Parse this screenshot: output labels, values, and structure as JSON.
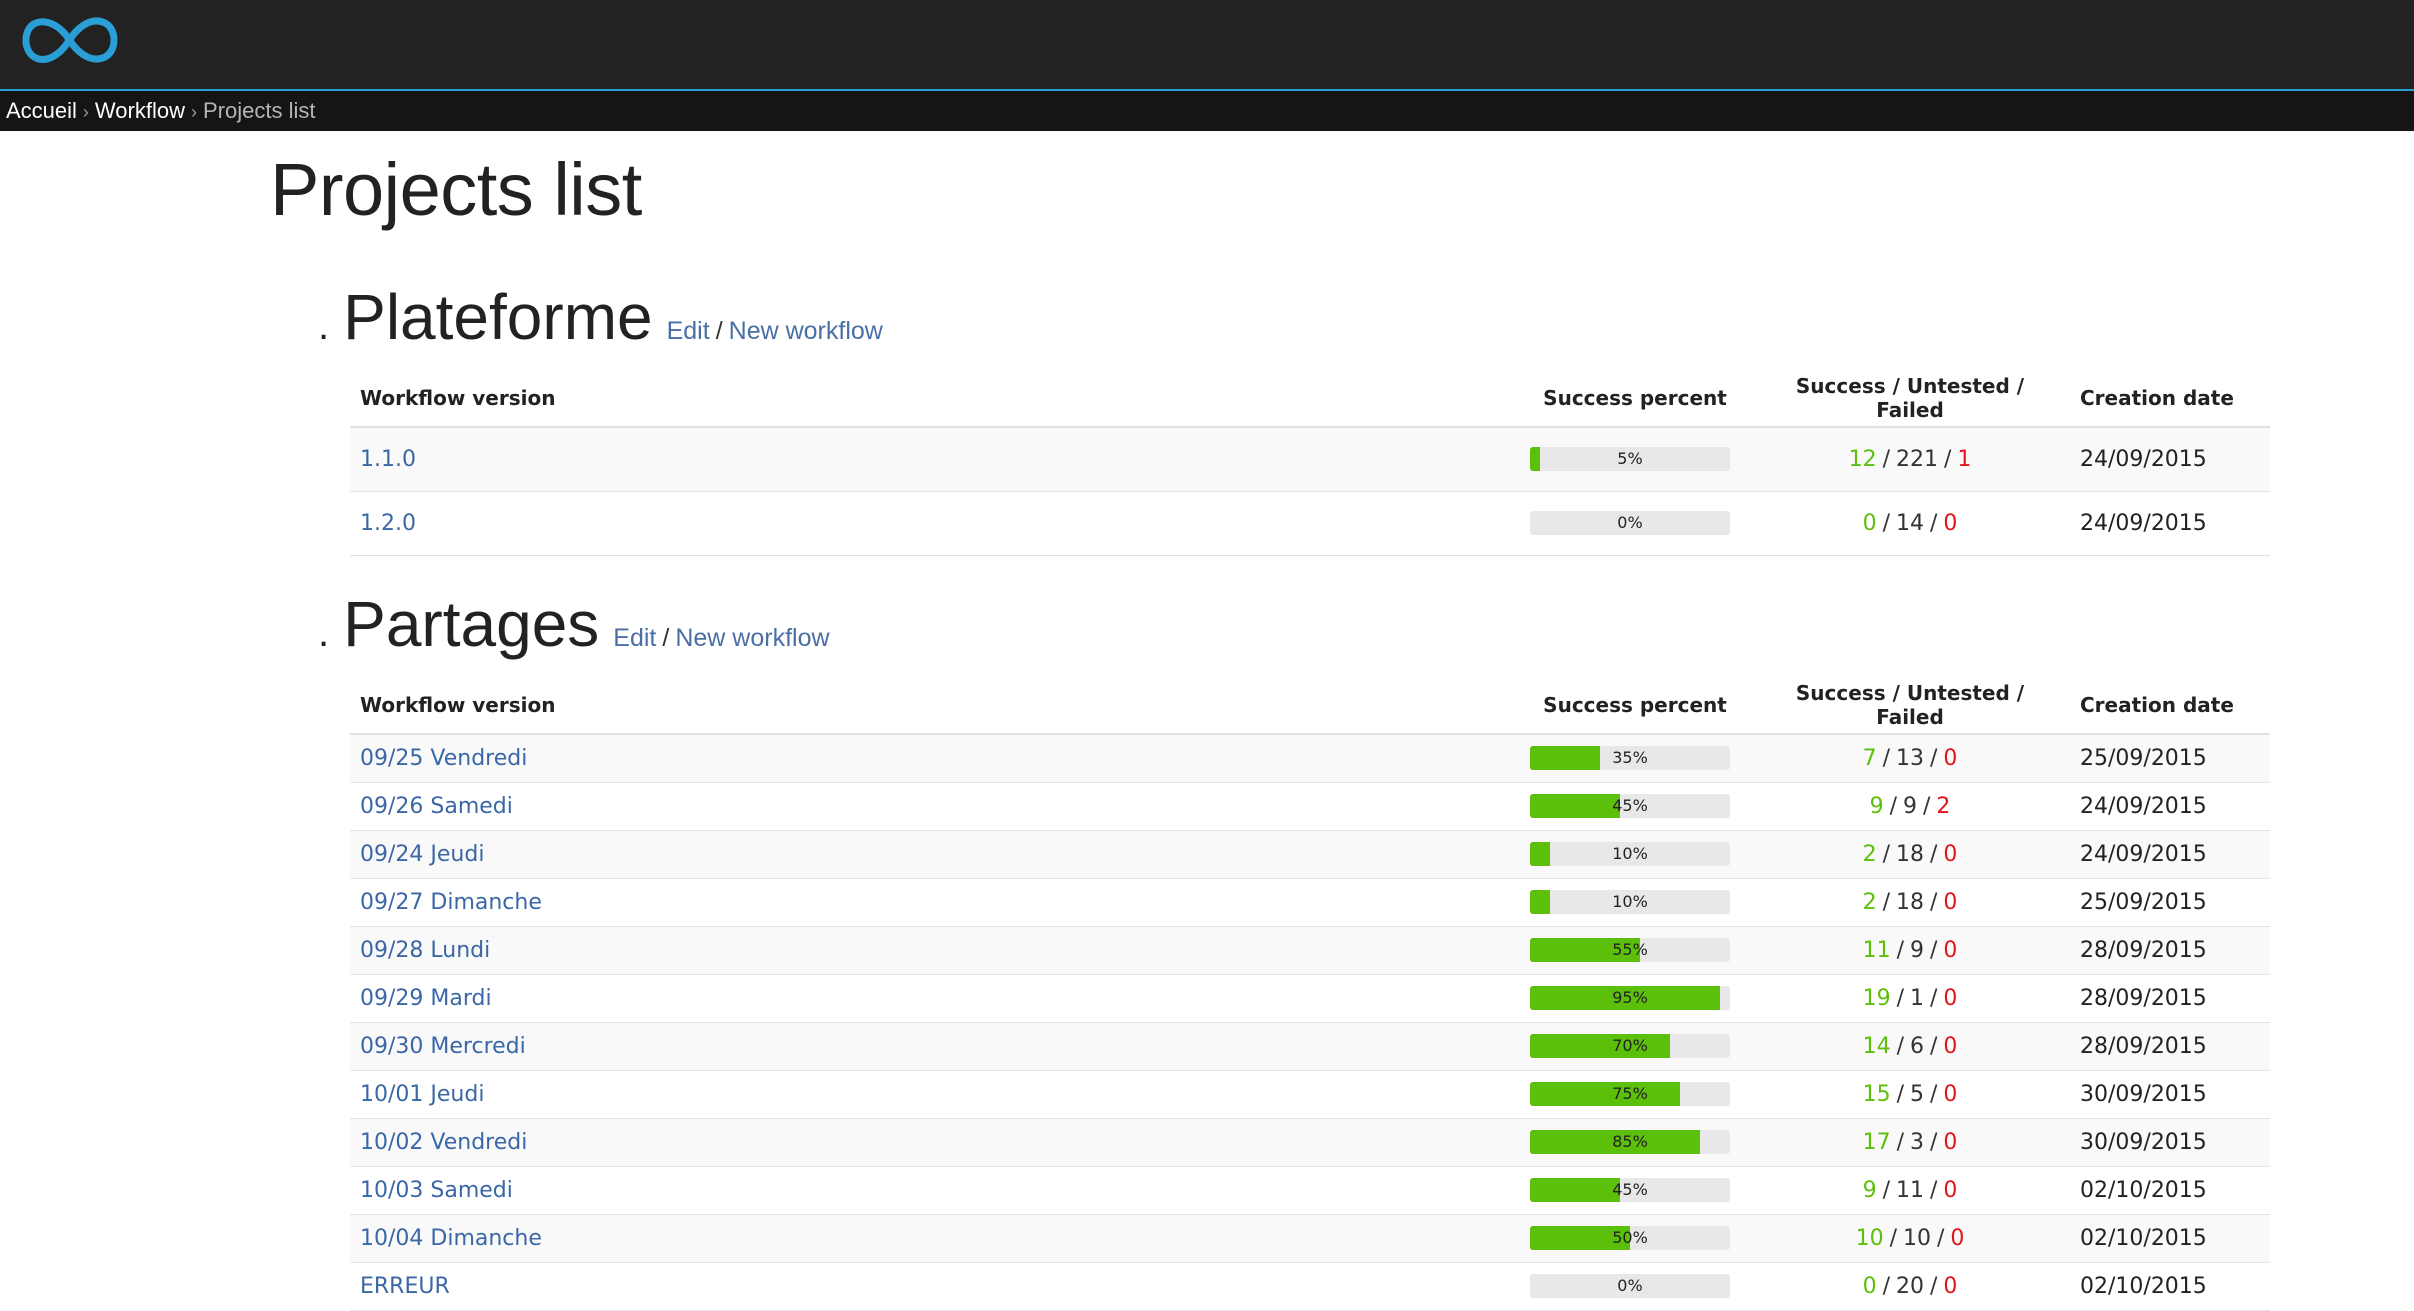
{
  "header": {
    "logo_icon": "infinity-logo-icon",
    "accent_color": "#2a9fd6"
  },
  "breadcrumb": {
    "items": [
      "Accueil",
      "Workflow"
    ],
    "separator": "›",
    "current": "Projects list"
  },
  "page": {
    "title": "Projects list"
  },
  "colors": {
    "success": "#5cbf0a",
    "failed": "#e3141b",
    "link": "#3a67a5"
  },
  "projects": [
    {
      "bullet": ".",
      "name": "Plateforme",
      "edit_label": "Edit",
      "links_separator": "/",
      "new_workflow_label": "New workflow",
      "columns": [
        "Workflow version",
        "Success percent",
        "Success / Untested / Failed",
        "Creation date"
      ],
      "rows": [
        {
          "version": "1.1.0",
          "percent": 5,
          "percent_label": "5%",
          "success": "12",
          "untested": "221",
          "failed": "1",
          "date": "24/09/2015"
        },
        {
          "version": "1.2.0",
          "percent": 0,
          "percent_label": "0%",
          "success": "0",
          "untested": "14",
          "failed": "0",
          "date": "24/09/2015"
        }
      ]
    },
    {
      "bullet": ".",
      "name": "Partages",
      "edit_label": "Edit",
      "links_separator": "/",
      "new_workflow_label": "New workflow",
      "columns": [
        "Workflow version",
        "Success percent",
        "Success / Untested / Failed",
        "Creation date"
      ],
      "rows": [
        {
          "version": "09/25 Vendredi",
          "percent": 35,
          "percent_label": "35%",
          "success": "7",
          "untested": "13",
          "failed": "0",
          "date": "25/09/2015"
        },
        {
          "version": "09/26 Samedi",
          "percent": 45,
          "percent_label": "45%",
          "success": "9",
          "untested": "9",
          "failed": "2",
          "date": "24/09/2015"
        },
        {
          "version": "09/24 Jeudi",
          "percent": 10,
          "percent_label": "10%",
          "success": "2",
          "untested": "18",
          "failed": "0",
          "date": "24/09/2015"
        },
        {
          "version": "09/27 Dimanche",
          "percent": 10,
          "percent_label": "10%",
          "success": "2",
          "untested": "18",
          "failed": "0",
          "date": "25/09/2015"
        },
        {
          "version": "09/28 Lundi",
          "percent": 55,
          "percent_label": "55%",
          "success": "11",
          "untested": "9",
          "failed": "0",
          "date": "28/09/2015"
        },
        {
          "version": "09/29 Mardi",
          "percent": 95,
          "percent_label": "95%",
          "success": "19",
          "untested": "1",
          "failed": "0",
          "date": "28/09/2015"
        },
        {
          "version": "09/30 Mercredi",
          "percent": 70,
          "percent_label": "70%",
          "success": "14",
          "untested": "6",
          "failed": "0",
          "date": "28/09/2015"
        },
        {
          "version": "10/01 Jeudi",
          "percent": 75,
          "percent_label": "75%",
          "success": "15",
          "untested": "5",
          "failed": "0",
          "date": "30/09/2015"
        },
        {
          "version": "10/02 Vendredi",
          "percent": 85,
          "percent_label": "85%",
          "success": "17",
          "untested": "3",
          "failed": "0",
          "date": "30/09/2015"
        },
        {
          "version": "10/03 Samedi",
          "percent": 45,
          "percent_label": "45%",
          "success": "9",
          "untested": "11",
          "failed": "0",
          "date": "02/10/2015"
        },
        {
          "version": "10/04 Dimanche",
          "percent": 50,
          "percent_label": "50%",
          "success": "10",
          "untested": "10",
          "failed": "0",
          "date": "02/10/2015"
        },
        {
          "version": "ERREUR",
          "percent": 0,
          "percent_label": "0%",
          "success": "0",
          "untested": "20",
          "failed": "0",
          "date": "02/10/2015"
        }
      ]
    }
  ]
}
